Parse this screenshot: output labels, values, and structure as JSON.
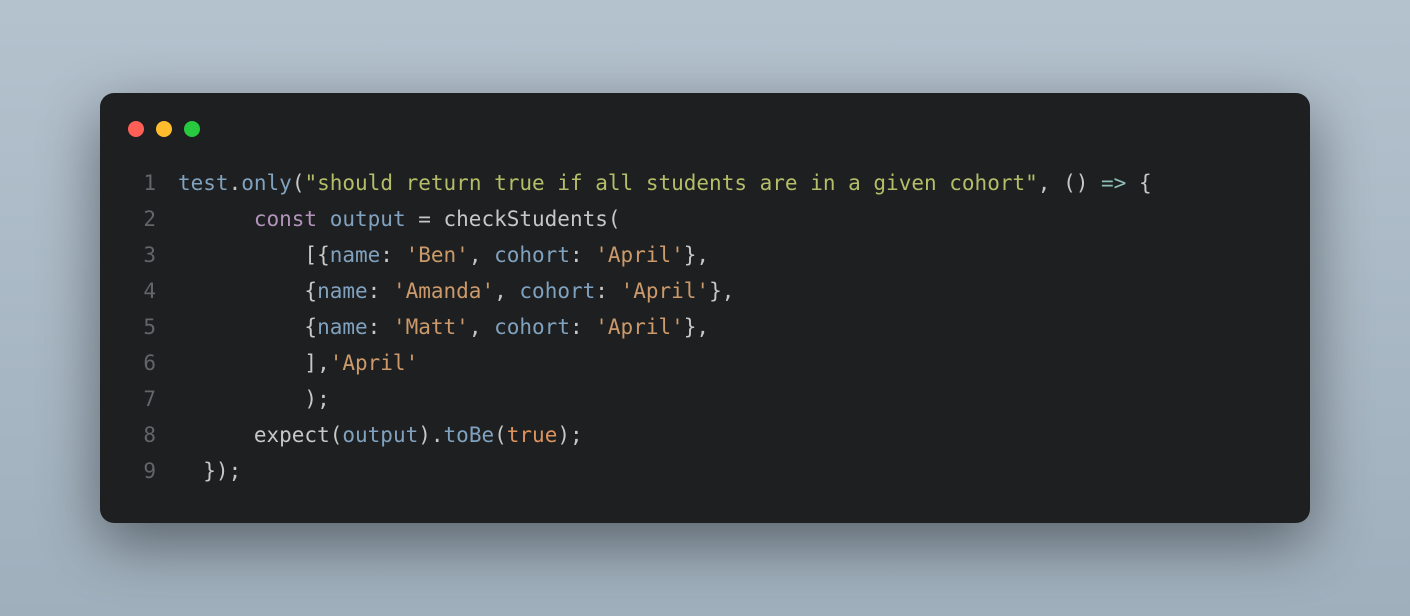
{
  "code": {
    "lines": [
      {
        "num": "1",
        "segments": [
          {
            "t": "test",
            "c": "tok-ident"
          },
          {
            "t": ".",
            "c": "tok-punct"
          },
          {
            "t": "only",
            "c": "tok-ident"
          },
          {
            "t": "(",
            "c": "tok-punct"
          },
          {
            "t": "\"should return true if all students are in a given cohort\"",
            "c": "tok-str"
          },
          {
            "t": ", () ",
            "c": "tok-punct"
          },
          {
            "t": "=>",
            "c": "tok-op"
          },
          {
            "t": " {",
            "c": "tok-punct"
          }
        ]
      },
      {
        "num": "2",
        "segments": [
          {
            "t": "      ",
            "c": "tok-punct"
          },
          {
            "t": "const",
            "c": "tok-key"
          },
          {
            "t": " ",
            "c": "tok-punct"
          },
          {
            "t": "output",
            "c": "tok-ident"
          },
          {
            "t": " = checkStudents(",
            "c": "tok-punct"
          }
        ]
      },
      {
        "num": "3",
        "segments": [
          {
            "t": "          [{",
            "c": "tok-punct"
          },
          {
            "t": "name",
            "c": "tok-ident"
          },
          {
            "t": ": ",
            "c": "tok-punct"
          },
          {
            "t": "'Ben'",
            "c": "tok-str2"
          },
          {
            "t": ", ",
            "c": "tok-punct"
          },
          {
            "t": "cohort",
            "c": "tok-ident"
          },
          {
            "t": ": ",
            "c": "tok-punct"
          },
          {
            "t": "'April'",
            "c": "tok-str2"
          },
          {
            "t": "},",
            "c": "tok-punct"
          }
        ]
      },
      {
        "num": "4",
        "segments": [
          {
            "t": "          {",
            "c": "tok-punct"
          },
          {
            "t": "name",
            "c": "tok-ident"
          },
          {
            "t": ": ",
            "c": "tok-punct"
          },
          {
            "t": "'Amanda'",
            "c": "tok-str2"
          },
          {
            "t": ", ",
            "c": "tok-punct"
          },
          {
            "t": "cohort",
            "c": "tok-ident"
          },
          {
            "t": ": ",
            "c": "tok-punct"
          },
          {
            "t": "'April'",
            "c": "tok-str2"
          },
          {
            "t": "},",
            "c": "tok-punct"
          }
        ]
      },
      {
        "num": "5",
        "segments": [
          {
            "t": "          {",
            "c": "tok-punct"
          },
          {
            "t": "name",
            "c": "tok-ident"
          },
          {
            "t": ": ",
            "c": "tok-punct"
          },
          {
            "t": "'Matt'",
            "c": "tok-str2"
          },
          {
            "t": ", ",
            "c": "tok-punct"
          },
          {
            "t": "cohort",
            "c": "tok-ident"
          },
          {
            "t": ": ",
            "c": "tok-punct"
          },
          {
            "t": "'April'",
            "c": "tok-str2"
          },
          {
            "t": "},",
            "c": "tok-punct"
          }
        ]
      },
      {
        "num": "6",
        "segments": [
          {
            "t": "          ],",
            "c": "tok-punct"
          },
          {
            "t": "'April'",
            "c": "tok-str2"
          }
        ]
      },
      {
        "num": "7",
        "segments": [
          {
            "t": "          );",
            "c": "tok-punct"
          }
        ]
      },
      {
        "num": "8",
        "segments": [
          {
            "t": "      expect(",
            "c": "tok-punct"
          },
          {
            "t": "output",
            "c": "tok-ident"
          },
          {
            "t": ").",
            "c": "tok-punct"
          },
          {
            "t": "toBe",
            "c": "tok-ident"
          },
          {
            "t": "(",
            "c": "tok-punct"
          },
          {
            "t": "true",
            "c": "tok-bool"
          },
          {
            "t": ");",
            "c": "tok-punct"
          }
        ]
      },
      {
        "num": "9",
        "segments": [
          {
            "t": "  });",
            "c": "tok-punct"
          }
        ]
      }
    ]
  }
}
